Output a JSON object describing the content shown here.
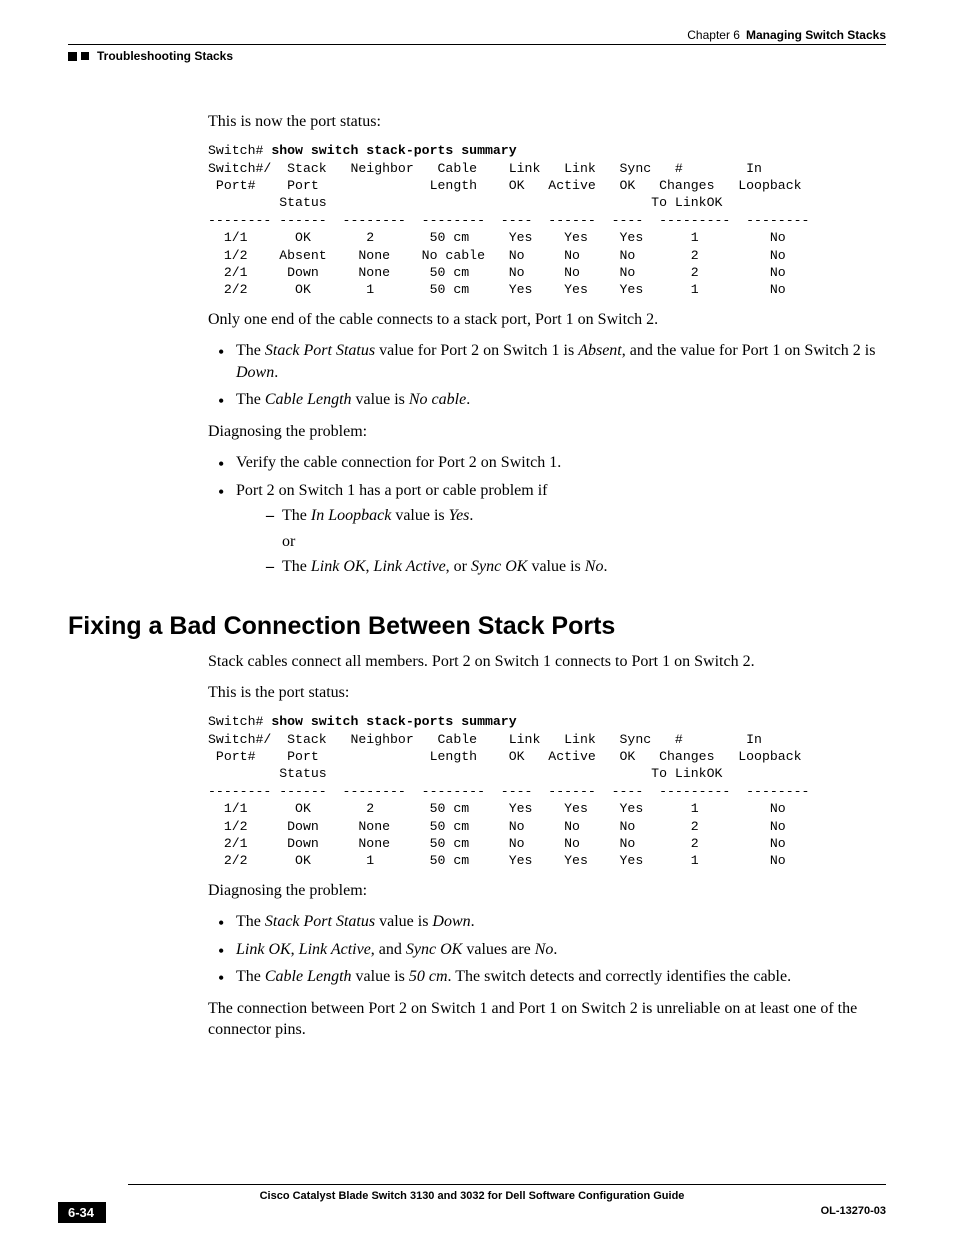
{
  "header": {
    "chapter_label": "Chapter 6",
    "chapter_title": "Managing Switch Stacks",
    "section_crumb": "Troubleshooting Stacks"
  },
  "s1": {
    "intro": "This is now the port status:",
    "cli_prompt": "Switch# ",
    "cli_cmd": "show switch stack-ports summary",
    "table": "Switch#/  Stack   Neighbor   Cable    Link   Link   Sync   #        In\n Port#    Port              Length    OK   Active   OK   Changes   Loopback\n         Status                                         To LinkOK\n-------- ------  --------  --------  ----  ------  ----  ---------  --------\n  1/1      OK       2       50 cm     Yes    Yes    Yes      1         No\n  1/2    Absent    None    No cable   No     No     No       2         No\n  2/1     Down     None     50 cm     No     No     No       2         No\n  2/2      OK       1       50 cm     Yes    Yes    Yes      1         No",
    "p_after": "Only one end of the cable connects to a stack port, Port 1 on Switch 2.",
    "b1_pre": "The ",
    "b1_em1": "Stack Port Status",
    "b1_mid1": " value for Port 2 on Switch 1 is ",
    "b1_em2": "Absent",
    "b1_mid2": ", and the value for Port 1 on Switch 2 is ",
    "b1_em3": "Down",
    "b1_post": ".",
    "b2_pre": "The ",
    "b2_em1": "Cable Length",
    "b2_mid": " value is ",
    "b2_em2": "No cable",
    "b2_post": ".",
    "diag": "Diagnosing the problem:",
    "d1": "Verify the cable connection for Port 2 on Switch 1.",
    "d2": "Port 2 on Switch 1 has a port or cable problem if",
    "d2a_pre": "The ",
    "d2a_em": "In Loopback",
    "d2a_mid": " value is ",
    "d2a_em2": "Yes",
    "d2a_post": ".",
    "or": "or",
    "d2b_pre": "The ",
    "d2b_em1": "Link OK",
    "d2b_c1": ", ",
    "d2b_em2": "Link Active",
    "d2b_c2": ", or ",
    "d2b_em3": "Sync OK",
    "d2b_mid": " value is ",
    "d2b_em4": "No",
    "d2b_post": "."
  },
  "s2": {
    "heading": "Fixing a Bad Connection Between Stack Ports",
    "p1": "Stack cables connect all members. Port 2 on Switch 1 connects to Port 1 on Switch 2.",
    "p2": "This is the port status:",
    "cli_prompt": "Switch# ",
    "cli_cmd": "show switch stack-ports summary",
    "table": "Switch#/  Stack   Neighbor   Cable    Link   Link   Sync   #        In\n Port#    Port              Length    OK   Active   OK   Changes   Loopback\n         Status                                         To LinkOK\n-------- ------  --------  --------  ----  ------  ----  ---------  --------\n  1/1      OK       2       50 cm     Yes    Yes    Yes      1         No\n  1/2     Down     None     50 cm     No     No     No       2         No\n  2/1     Down     None     50 cm     No     No     No       2         No\n  2/2      OK       1       50 cm     Yes    Yes    Yes      1         No",
    "diag": "Diagnosing the problem:",
    "b1_pre": "The ",
    "b1_em": "Stack Port Status",
    "b1_mid": " value is ",
    "b1_em2": "Down",
    "b1_post": ".",
    "b2_em1": "Link OK",
    "b2_c1": ", ",
    "b2_em2": "Link Active",
    "b2_c2": ", and ",
    "b2_em3": "Sync OK",
    "b2_mid": " values are ",
    "b2_em4": "No",
    "b2_post": ".",
    "b3_pre": "The ",
    "b3_em1": "Cable Length",
    "b3_mid": " value is ",
    "b3_em2": "50 cm",
    "b3_post": ". The switch detects and correctly identifies the cable.",
    "p3": "The connection between Port 2 on Switch 1 and Port 1 on Switch 2 is unreliable on at least one of the connector pins."
  },
  "footer": {
    "book": "Cisco Catalyst Blade Switch 3130 and 3032 for Dell Software Configuration Guide",
    "page": "6-34",
    "doc": "OL-13270-03"
  }
}
